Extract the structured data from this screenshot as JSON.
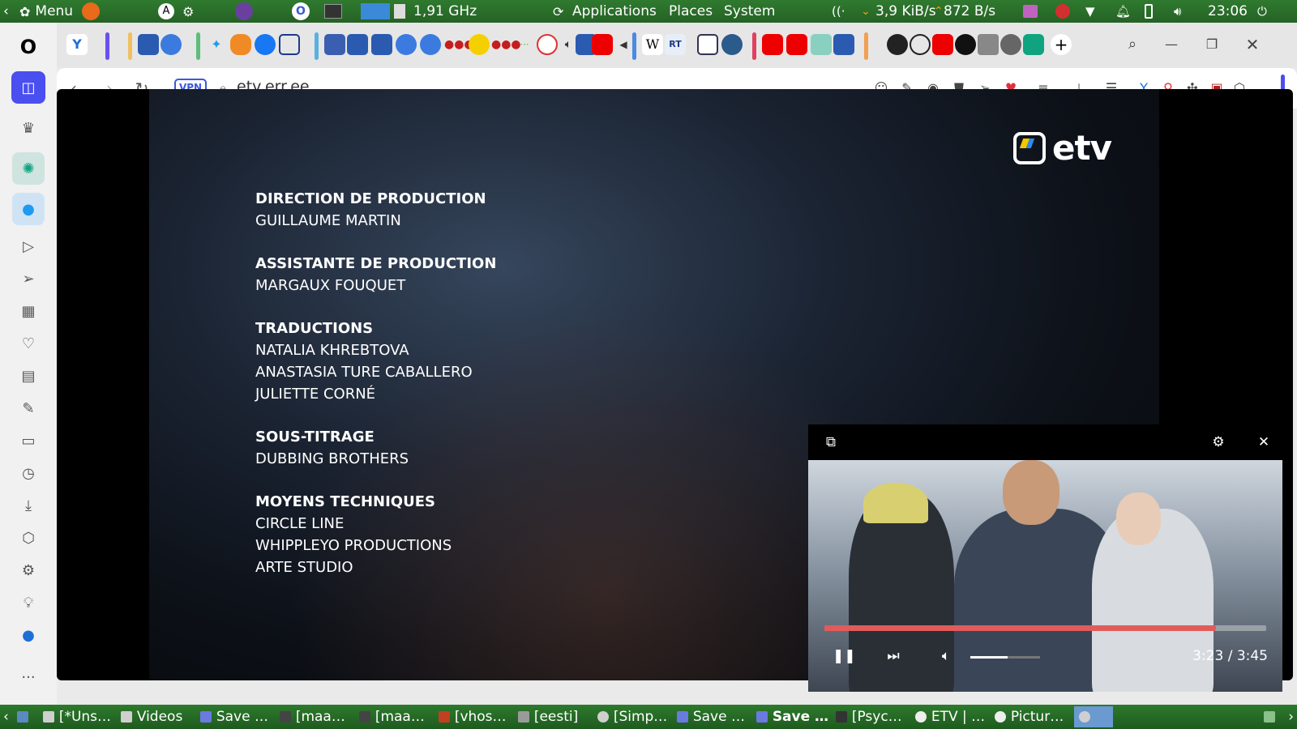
{
  "system_panel": {
    "menu_label": "Menu",
    "cpu": "1,91 GHz",
    "applications": "Applications",
    "places": "Places",
    "system": "System",
    "net_down": "3,9 KiB/s",
    "net_up": "872 B/s",
    "clock": "23:06"
  },
  "browser": {
    "url": "etv.err.ee",
    "vpn_label": "VPN",
    "tab_icons": [
      "valve-icon",
      "err-icon",
      "pm-icon",
      "twitter-icon",
      "metamask-icon",
      "facebook-icon",
      "qr-icon",
      "err-icon",
      "err-icon",
      "err-icon",
      "pm-icon",
      "pm-icon",
      "dots-icon",
      "k-icon",
      "dots-icon",
      "dots-icon",
      "clock-icon",
      "speaker-icon",
      "youtube-icon",
      "wikipedia-icon",
      "rt-icon",
      "pen-icon",
      "map-icon",
      "youtube-icon",
      "youtube-icon",
      "chart-icon",
      "err-icon",
      "openai-icon",
      "openai-icon",
      "youtube-icon",
      "unv-icon",
      "grid-icon",
      "globe-icon",
      "openai-icon"
    ],
    "new_tab_label": "+"
  },
  "video": {
    "channel": "etv",
    "credits": [
      {
        "role": "DIRECTION DE PRODUCTION",
        "names": [
          "GUILLAUME MARTIN"
        ]
      },
      {
        "role": "ASSISTANTE DE PRODUCTION",
        "names": [
          "MARGAUX FOUQUET"
        ]
      },
      {
        "role": "TRADUCTIONS",
        "names": [
          "NATALIA KHREBTOVA",
          "ANASTASIA TURE CABALLERO",
          "JULIETTE CORNÉ"
        ]
      },
      {
        "role": "SOUS-TITRAGE",
        "names": [
          "DUBBING BROTHERS"
        ]
      },
      {
        "role": "MOYENS TECHNIQUES",
        "names": [
          "CIRCLE LINE",
          "WHIPPLEYO PRODUCTIONS",
          "ARTE STUDIO"
        ]
      }
    ]
  },
  "pip": {
    "time": "3:23 / 3:45",
    "progress_fraction": 0.886,
    "volume_fraction": 0.53
  },
  "taskbar": {
    "items": [
      "[*Uns…",
      "Videos",
      "Save …",
      "[maa…",
      "[maa…",
      "[vhos…",
      "[eesti]",
      "[Simp…",
      "Save …",
      "Save …",
      "[Psyc…",
      "ETV | …",
      "Pictur…"
    ]
  },
  "colors": {
    "panel_green": "#2a6a2a",
    "sidebar_accent": "#4a4ff0",
    "progress_red": "#e25b5b",
    "etv_yellow": "#f5c500",
    "etv_blue": "#2c8be8"
  }
}
